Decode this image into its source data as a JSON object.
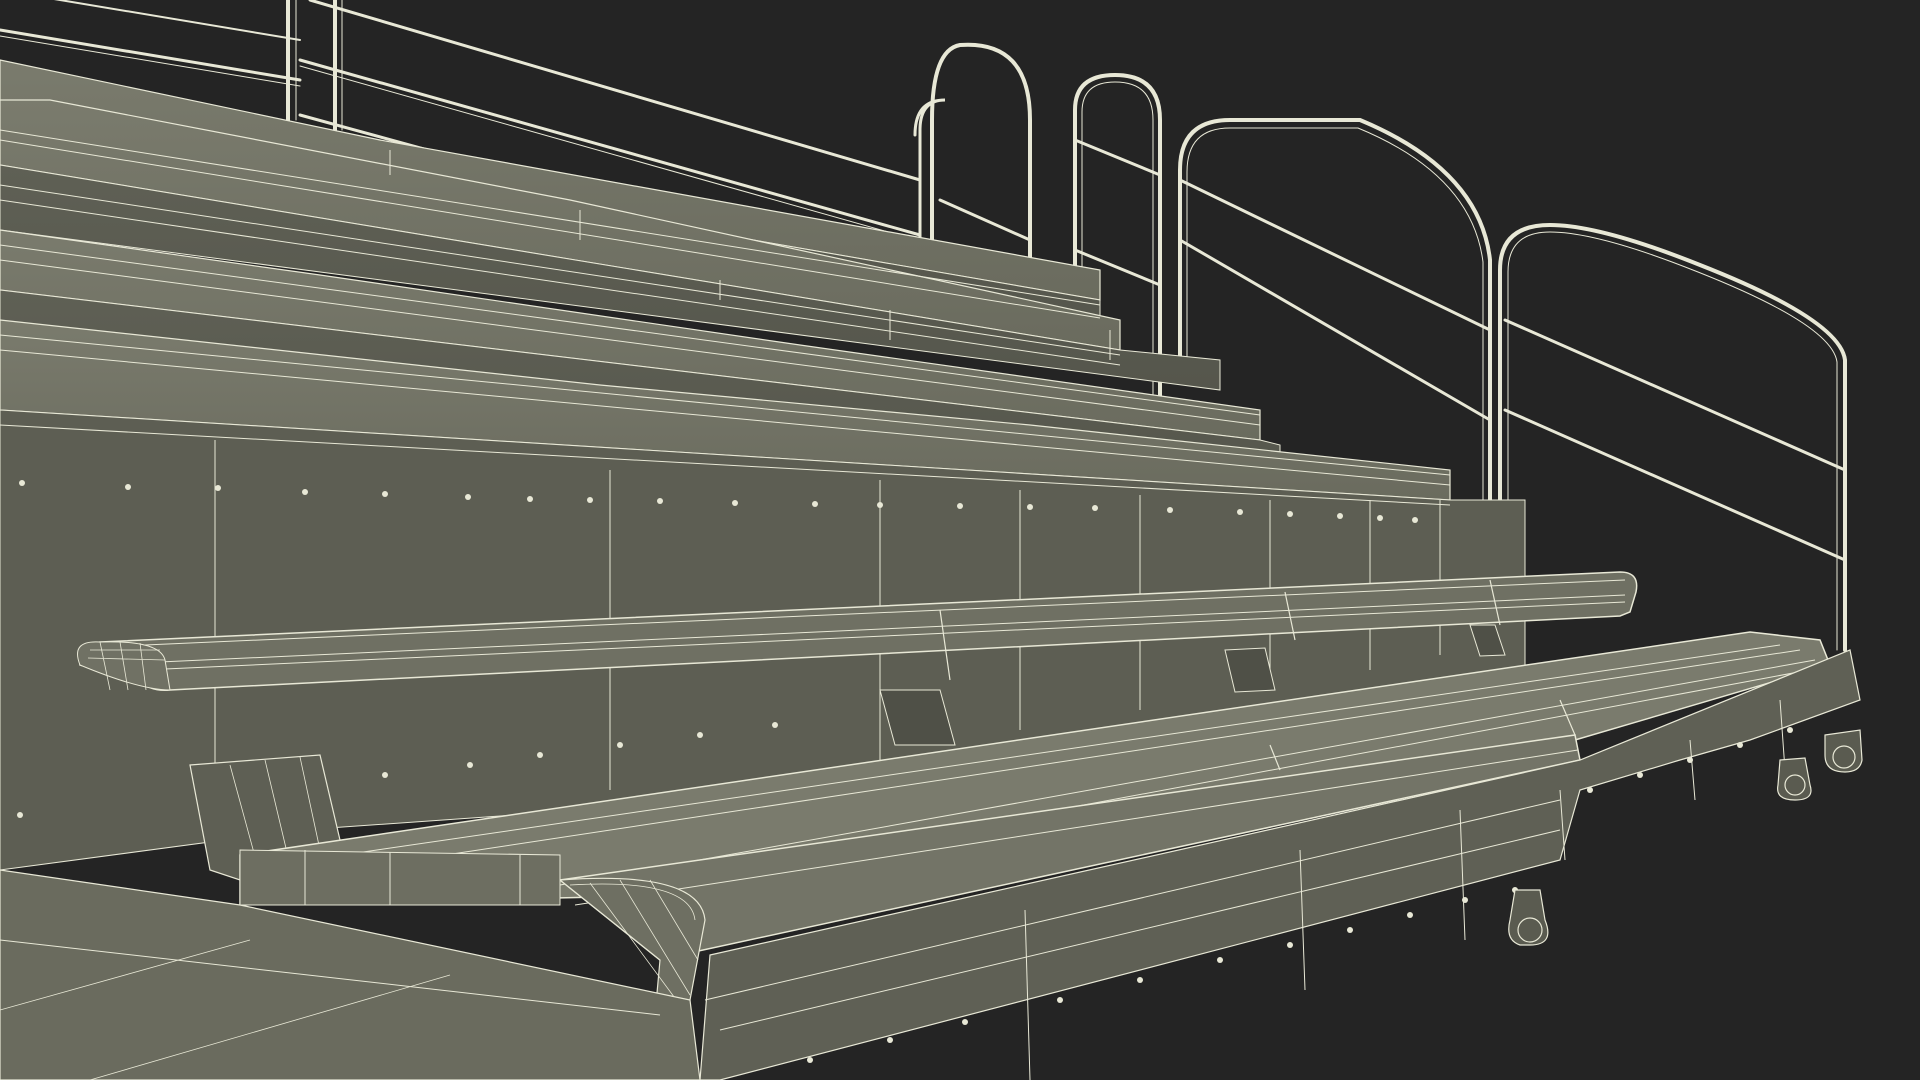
{
  "scene": {
    "subject": "bleacher-wireframe-render",
    "colors": {
      "background": "#242424",
      "surface": "#6b6c5f",
      "surface_dark": "#5a5b50",
      "surface_light": "#7b7c6e",
      "wire": "#e8e8d6",
      "wire_dim": "#c9c9b6",
      "rail": "#8a8b7c"
    },
    "render_style": "wireframe-over-flat-shading",
    "rows": 6,
    "has_railing": true,
    "has_casters": true
  }
}
